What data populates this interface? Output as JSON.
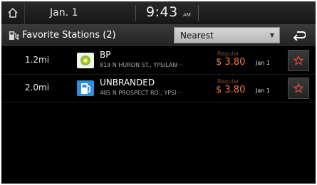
{
  "status": {
    "date": "Jan.  1",
    "time": "9:43",
    "ampm": "AM"
  },
  "toolbar": {
    "title": "Favorite Stations (2)",
    "sort_value": "Nearest"
  },
  "stations": [
    {
      "distance": "1.2mi",
      "name": "BP",
      "address": "819 N HURON ST., YPSILAN···",
      "fuel_type": "Regular",
      "price": "$ 3.80",
      "date": "Jan 1"
    },
    {
      "distance": "2.0mi",
      "name": "UNBRANDED",
      "address": "405 N PROSPECT RD., YPSI···",
      "fuel_type": "Regular",
      "price": "$ 3.80",
      "date": "Jan 1"
    }
  ],
  "colors": {
    "price": "#f07a46",
    "star": "#e04a3a",
    "bp_logo": "#7fc142",
    "unbranded_logo": "#2f8fd8"
  },
  "icons": {
    "home": "home-icon",
    "title": "fuel-station-list-icon",
    "back": "back-icon",
    "favorite": "star-outline-icon"
  }
}
